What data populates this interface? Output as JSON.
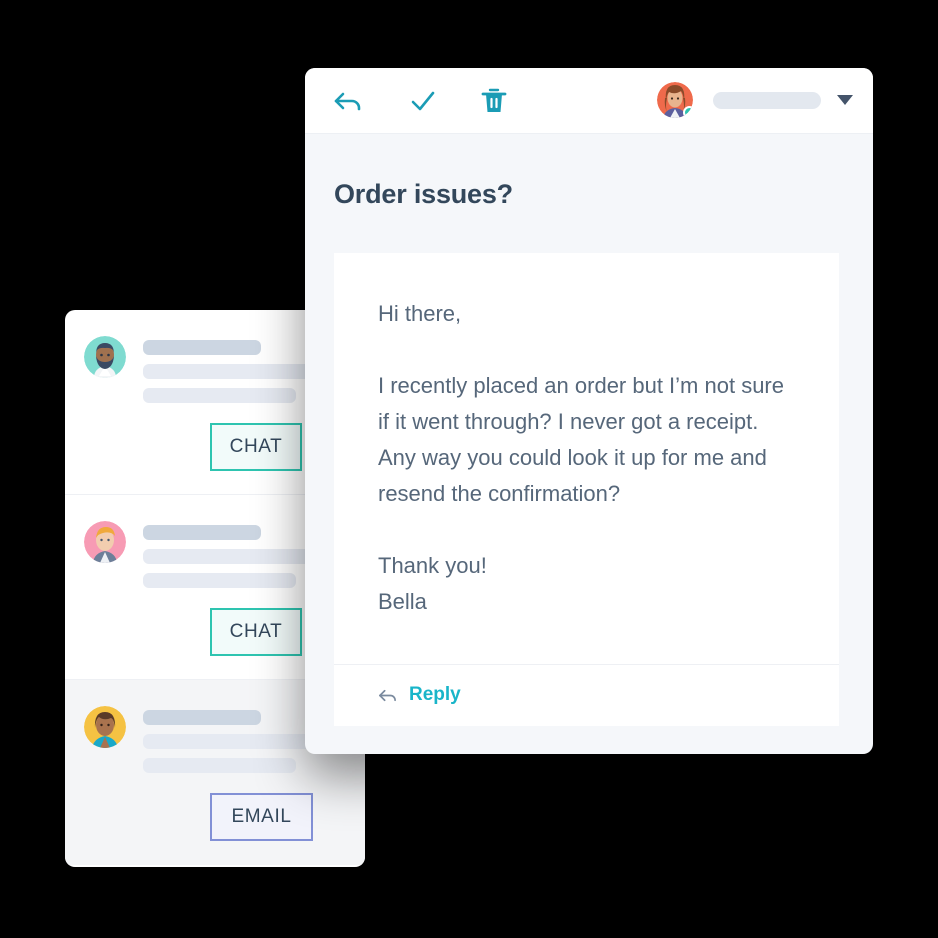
{
  "background_color": "#000000",
  "accent_teal": "#2ec4b0",
  "accent_icon_teal": "#1b9cb5",
  "accent_link_teal": "#19b5c9",
  "accent_purple": "#8290d6",
  "text_dark": "#33475b",
  "mail": {
    "toolbar": {
      "reply_icon": "reply-arrow-icon",
      "approve_icon": "check-icon",
      "delete_icon": "trash-icon",
      "avatar_icon": "user-avatar",
      "status": "online",
      "account_name": "",
      "dropdown_icon": "chevron-down-icon"
    },
    "subject": "Order issues?",
    "body": {
      "greeting": "Hi there,",
      "paragraph": "I recently placed an order but I’m not sure if it went through? I never got a receipt. Any way you could look it up for me and resend the confirmation?",
      "closing": "Thank you!",
      "signature": "Bella"
    },
    "reply_action": {
      "icon": "reply-arrow-icon",
      "label": "Reply"
    }
  },
  "conversations": {
    "items": [
      {
        "avatar_name": "avatar-bearded-man",
        "avatar_bg": "#7fdbd0",
        "channel_badge": "CHAT",
        "badge_type": "chat",
        "selected": false
      },
      {
        "avatar_name": "avatar-blond-man",
        "avatar_bg": "#f79bb4",
        "channel_badge": "CHAT",
        "badge_type": "chat",
        "selected": false
      },
      {
        "avatar_name": "avatar-woman",
        "avatar_bg": "#f5c243",
        "channel_badge": "EMAIL",
        "badge_type": "email",
        "selected": true
      }
    ]
  }
}
